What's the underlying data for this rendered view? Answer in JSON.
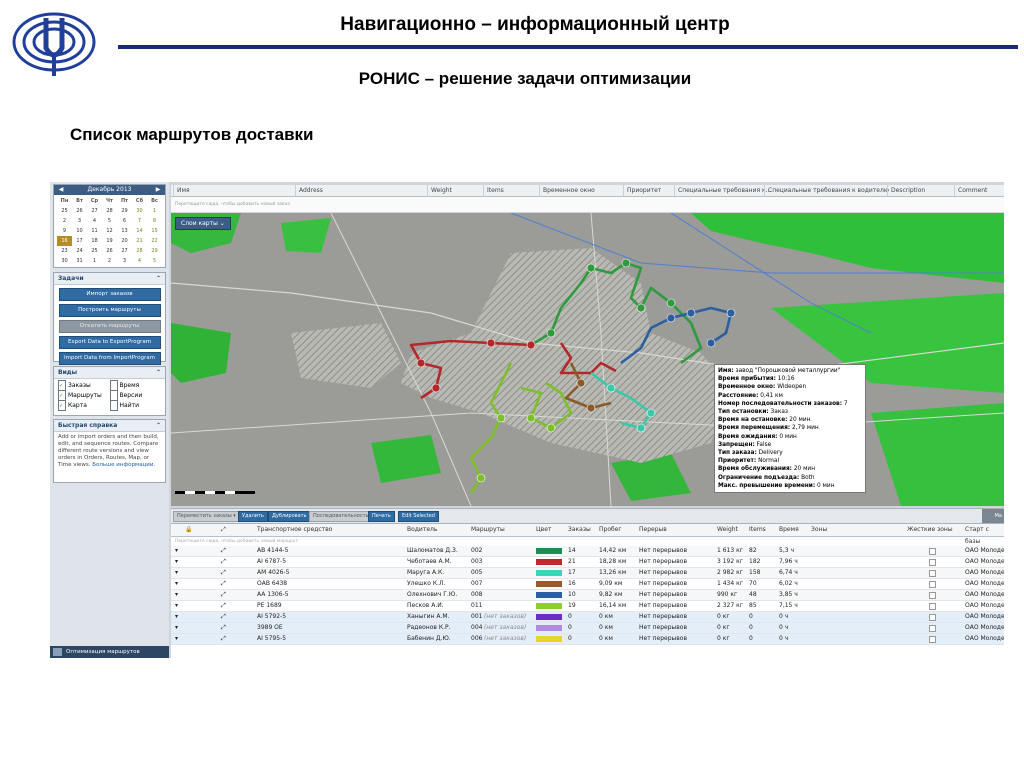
{
  "slide": {
    "title": "Навигационно – информационный центр",
    "subtitle": "РОНИС – решение задачи оптимизации",
    "section_heading": "Список маршрутов доставки"
  },
  "calendar": {
    "month": "Декабрь 2013",
    "day_headers": [
      "Пн",
      "Вт",
      "Ср",
      "Чт",
      "Пт",
      "Сб",
      "Вс"
    ],
    "weeks": [
      [
        "25",
        "26",
        "27",
        "28",
        "29",
        "30",
        "1"
      ],
      [
        "2",
        "3",
        "4",
        "5",
        "6",
        "7",
        "8"
      ],
      [
        "9",
        "10",
        "11",
        "12",
        "13",
        "14",
        "15"
      ],
      [
        "16",
        "17",
        "18",
        "19",
        "20",
        "21",
        "22"
      ],
      [
        "23",
        "24",
        "25",
        "26",
        "27",
        "28",
        "29"
      ],
      [
        "30",
        "31",
        "1",
        "2",
        "3",
        "4",
        "5"
      ]
    ],
    "selected_day": "16"
  },
  "tasks": {
    "header": "Задачи",
    "buttons": [
      "Импорт заказов",
      "Построить маршруты",
      "Откатить маршруты",
      "Export Data to ExportProgram",
      "Import Data from ImportProgram"
    ]
  },
  "views": {
    "header": "Виды",
    "items": [
      {
        "label": "Заказы",
        "checked": true
      },
      {
        "label": "Время",
        "checked": false
      },
      {
        "label": "Маршруты",
        "checked": true
      },
      {
        "label": "Версии",
        "checked": false
      },
      {
        "label": "Карта",
        "checked": true
      },
      {
        "label": "Найти",
        "checked": false
      }
    ]
  },
  "quick_help": {
    "header": "Быстрая справка",
    "text": "Add or import orders and then build, edit, and sequence routes. Compare different route versions and view orders in Orders, Routes, Map, or Time views.",
    "link": "Больше информации."
  },
  "left_footer": "Оптимизация маршрутов",
  "order_columns": [
    "Имя",
    "Address",
    "Weight",
    "Items",
    "Временное окно",
    "Приоритет",
    "Специальные требования к...",
    "Специальные требования к водителю",
    "Description",
    "Comment"
  ],
  "order_empty_hint": "Перетащите сюда, чтобы добавить новый заказ",
  "map": {
    "layers_button": "Слои карты",
    "info": [
      {
        "k": "Имя:",
        "v": "завод \"Порошковой металлургии\""
      },
      {
        "k": "Время прибытия:",
        "v": "10:16"
      },
      {
        "k": "Временное окно:",
        "v": "Wideopen"
      },
      {
        "k": "Расстояние:",
        "v": "0,41 км"
      },
      {
        "k": "Номер последовательности заказов:",
        "v": "7"
      },
      {
        "k": "Тип остановки:",
        "v": "Заказ"
      },
      {
        "k": "Время на остановке:",
        "v": "20 мин"
      },
      {
        "k": "Время перемещения:",
        "v": "2,79 мин"
      },
      {
        "k": "Время ожидания:",
        "v": "0 мин"
      },
      {
        "k": "Запрещен:",
        "v": "False"
      },
      {
        "k": "Тип заказа:",
        "v": "Delivery"
      },
      {
        "k": "Приоритет:",
        "v": "Normal"
      },
      {
        "k": "Время обслуживания:",
        "v": "20 мин"
      },
      {
        "k": "Ограничение подъезда:",
        "v": "Both"
      },
      {
        "k": "Макс. превышение времени:",
        "v": "0 мин"
      }
    ],
    "routes": [
      {
        "color": "#2f9a3e",
        "stops": [
          "1",
          "2",
          "3",
          "4",
          "5",
          "6",
          "7"
        ]
      },
      {
        "color": "#b3282b",
        "stops": [
          "11",
          "12",
          "13",
          "14",
          "15",
          "16",
          "17"
        ]
      },
      {
        "color": "#2b5fa0",
        "stops": [
          "1",
          "2",
          "3",
          "4",
          "5",
          "6",
          "7"
        ]
      },
      {
        "color": "#7dbf2a",
        "stops": [
          "8",
          "9",
          "10",
          "11",
          "12",
          "13"
        ]
      },
      {
        "color": "#3ac8a8",
        "stops": [
          "1",
          "2",
          "3",
          "4",
          "5",
          "6",
          "7",
          "8"
        ]
      },
      {
        "color": "#8a5a2a",
        "stops": [
          "2",
          "3",
          "4",
          "5",
          "6",
          "7"
        ]
      }
    ]
  },
  "toolbar": {
    "move": "Переместить заказы",
    "delete": "Удалить",
    "duplicate": "Дублировать",
    "sequence": "Последовательность",
    "print": "Печать",
    "edit": "Edit Selected",
    "corner": "Ma"
  },
  "routes_table": {
    "headers": [
      "Транспортное средство",
      "Водитель",
      "Маршруты",
      "Цвет",
      "Заказы",
      "Пробег",
      "Перерыв",
      "Weight",
      "Items",
      "Время",
      "Зоны",
      "Жесткие зоны",
      "Старт с базы"
    ],
    "empty_hint": "Перетащите сюда, чтобы добавить новый маршрут",
    "rows": [
      {
        "vehicle": "АВ 4144-5",
        "driver": "Шаломатов Д.З.",
        "route": "002",
        "route_note": "",
        "color": "#1f8a52",
        "orders": "14",
        "distance": "14,42 км",
        "break": "Нет перерывов",
        "weight": "1 613 кг",
        "items": "82",
        "time": "5,3 ч",
        "start": "ОАО Молоде"
      },
      {
        "vehicle": "AI 6787-5",
        "driver": "Чеботаев А.М.",
        "route": "003",
        "route_note": "",
        "color": "#c0282b",
        "orders": "21",
        "distance": "18,28 км",
        "break": "Нет перерывов",
        "weight": "3 192 кг",
        "items": "182",
        "time": "7,96 ч",
        "start": "ОАО Молоде"
      },
      {
        "vehicle": "AM 4026-5",
        "driver": "Маруга А.К.",
        "route": "005",
        "route_note": "",
        "color": "#3ad6b8",
        "orders": "17",
        "distance": "13,26 км",
        "break": "Нет перерывов",
        "weight": "2 982 кг",
        "items": "158",
        "time": "6,74 ч",
        "start": "ОАО Молоде"
      },
      {
        "vehicle": "ОАВ 6438",
        "driver": "Улешко К.Л.",
        "route": "007",
        "route_note": "",
        "color": "#9a5a2a",
        "orders": "16",
        "distance": "9,09 км",
        "break": "Нет перерывов",
        "weight": "1 434 кг",
        "items": "70",
        "time": "6,02 ч",
        "start": "ОАО Молоде"
      },
      {
        "vehicle": "AA 1306-5",
        "driver": "Олехнович Г.Ю.",
        "route": "008",
        "route_note": "",
        "color": "#2b5fa0",
        "orders": "10",
        "distance": "9,82 км",
        "break": "Нет перерывов",
        "weight": "990 кг",
        "items": "48",
        "time": "3,85 ч",
        "start": "ОАО Молоде"
      },
      {
        "vehicle": "РЕ 1689",
        "driver": "Песков А.И.",
        "route": "011",
        "route_note": "",
        "color": "#8ccf2a",
        "orders": "19",
        "distance": "16,14 км",
        "break": "Нет перерывов",
        "weight": "2 327 кг",
        "items": "85",
        "time": "7,15 ч",
        "start": "ОАО Молоде"
      },
      {
        "vehicle": "AI 5792-5",
        "driver": "Ханыгин А.М.",
        "route": "001",
        "route_note": "(нет заказов)",
        "color": "#6a2fc0",
        "orders": "0",
        "distance": "0 км",
        "break": "Нет перерывов",
        "weight": "0 кг",
        "items": "0",
        "time": "0 ч",
        "start": "ОАО Молоде"
      },
      {
        "vehicle": "3989 ОЕ",
        "driver": "Радеонов К.Р.",
        "route": "004",
        "route_note": "(нет заказов)",
        "color": "#b08ae0",
        "orders": "0",
        "distance": "0 км",
        "break": "Нет перерывов",
        "weight": "0 кг",
        "items": "0",
        "time": "0 ч",
        "start": "ОАО Молоде"
      },
      {
        "vehicle": "AI 5795-5",
        "driver": "Бабенин Д.Ю.",
        "route": "006",
        "route_note": "(нет заказов)",
        "color": "#e8d42a",
        "orders": "0",
        "distance": "0 км",
        "break": "Нет перерывов",
        "weight": "0 кг",
        "items": "0",
        "time": "0 ч",
        "start": "ОАО Молоде"
      }
    ]
  }
}
